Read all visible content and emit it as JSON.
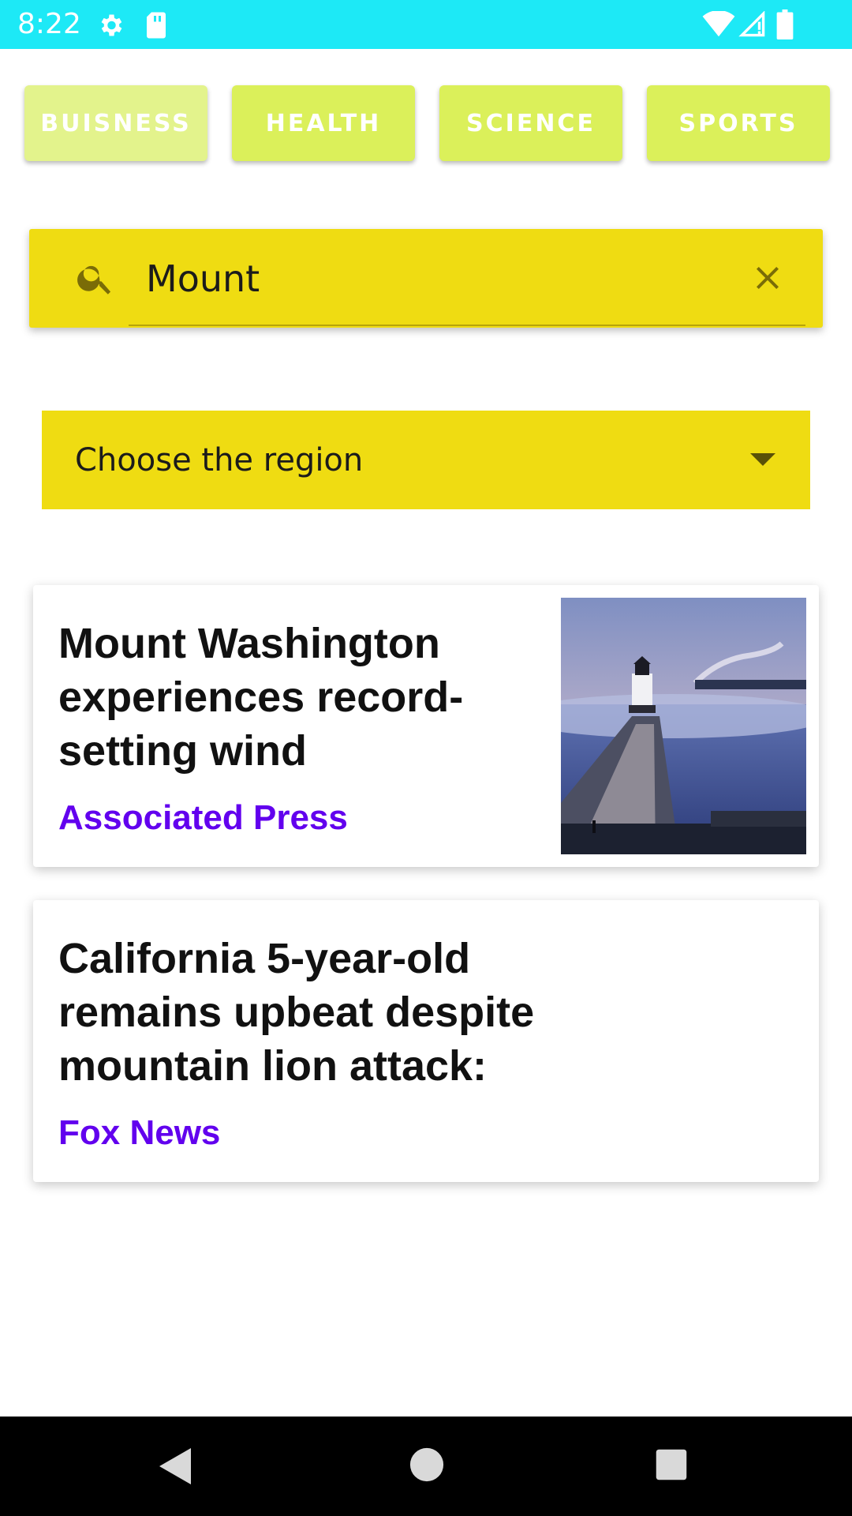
{
  "status_bar": {
    "time": "8:22",
    "background": "#1de9f6",
    "icons": [
      "gear-icon",
      "sd-card-icon",
      "wifi-icon",
      "cell-signal-icon",
      "battery-icon"
    ]
  },
  "categories": [
    {
      "label": "BUISNESS",
      "pressed": true
    },
    {
      "label": "HEALTH",
      "pressed": false
    },
    {
      "label": "SCIENCE",
      "pressed": false
    },
    {
      "label": "SPORTS",
      "pressed": false
    }
  ],
  "search": {
    "value": "Mount",
    "icon": "search-icon",
    "clear_icon": "close-icon"
  },
  "region": {
    "label": "Choose the region",
    "icon": "dropdown-arrow-icon"
  },
  "articles": [
    {
      "title": "Mount Washington experiences record-setting wind",
      "source": "Associated Press",
      "has_image": true
    },
    {
      "title": "California 5-year-old remains upbeat despite mountain lion attack:",
      "source": "Fox News",
      "has_image": false
    }
  ],
  "colors": {
    "category_button": "#dbf05a",
    "search_bg": "#efdc12",
    "source_text": "#6200ee"
  },
  "nav_bar": {
    "icons": [
      "back-icon",
      "home-icon",
      "recents-icon"
    ]
  }
}
